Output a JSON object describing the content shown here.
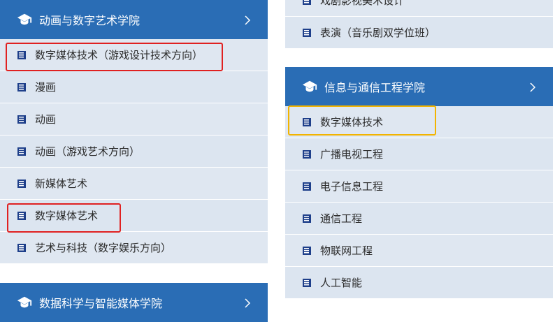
{
  "left": {
    "college1": {
      "title": "动画与数字艺术学院",
      "items": [
        "数字媒体技术（游戏设计技术方向）",
        "漫画",
        "动画",
        "动画（游戏艺术方向）",
        "新媒体艺术",
        "数字媒体艺术",
        "艺术与科技（数字娱乐方向）"
      ]
    },
    "college2": {
      "title": "数据科学与智能媒体学院"
    }
  },
  "right": {
    "college0": {
      "items": [
        "戏剧影视美术设计",
        "表演（音乐剧双学位班）"
      ]
    },
    "college1": {
      "title": "信息与通信工程学院",
      "items": [
        "数字媒体技术",
        "广播电视工程",
        "电子信息工程",
        "通信工程",
        "物联网工程",
        "人工智能"
      ]
    }
  },
  "icons": {
    "header": "graduation-cap-icon",
    "item": "book-icon",
    "chevron": "chevron-right-icon"
  },
  "colors": {
    "header_bg": "#2a6db5",
    "item_bg": "#dfe7f1",
    "highlight_red": "#e02121",
    "highlight_yellow": "#f2b400"
  }
}
